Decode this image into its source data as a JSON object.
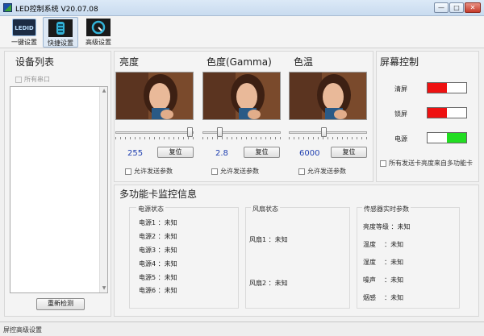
{
  "window": {
    "title": "LED控制系统 V20.07.08",
    "minimize": "—",
    "maximize": "□",
    "close": "✕"
  },
  "toolbar": {
    "tools": [
      {
        "label": "一键设置",
        "icon_text": "LEDID",
        "icon": "led-id-icon"
      },
      {
        "label": "快捷设置",
        "icon_text": "",
        "icon": "chip-icon"
      },
      {
        "label": "高级设置",
        "icon_text": "",
        "icon": "gauge-icon"
      }
    ]
  },
  "devices": {
    "title": "设备列表",
    "all_ports": "所有串口",
    "redetect": "重新检测"
  },
  "adjust": {
    "panels": [
      {
        "title": "亮度",
        "value": "255",
        "slider_level": 1.0,
        "reset": "复位",
        "allow_send": "允许发送参数"
      },
      {
        "title": "色度(Gamma)",
        "value": "2.8",
        "slider_level": 0.2,
        "reset": "复位",
        "allow_send": "允许发送参数"
      },
      {
        "title": "色温",
        "value": "6000",
        "slider_level": 0.45,
        "reset": "复位",
        "allow_send": "允许发送参数"
      }
    ]
  },
  "screen_control": {
    "title": "屏幕控制",
    "items": [
      {
        "label": "清屏",
        "state": "off",
        "color": "#ee1111"
      },
      {
        "label": "锁屏",
        "state": "off",
        "color": "#ee1111"
      },
      {
        "label": "电源",
        "state": "on",
        "color": "#22dd22"
      }
    ],
    "all_cards_brightness": "所有发送卡亮度来自多功能卡"
  },
  "monitor": {
    "title": "多功能卡监控信息",
    "power": {
      "title": "电源状态",
      "items": [
        "电源1 ：未知",
        "电源2 ：未知",
        "电源3 ：未知",
        "电源4 ：未知",
        "电源5 ：未知",
        "电源6 ：未知"
      ]
    },
    "fan": {
      "title": "风扇状态",
      "items": [
        "风扇1 ：未知",
        "风扇2 ：未知"
      ]
    },
    "sensors": {
      "title": "传感器实时参数",
      "items": [
        "亮度等级 ：未知",
        "温度    ：未知",
        "湿度    ：未知",
        "噪声    ：未知",
        "烟感    ：未知"
      ]
    }
  },
  "statusbar": {
    "text": "屏控高级设置"
  }
}
